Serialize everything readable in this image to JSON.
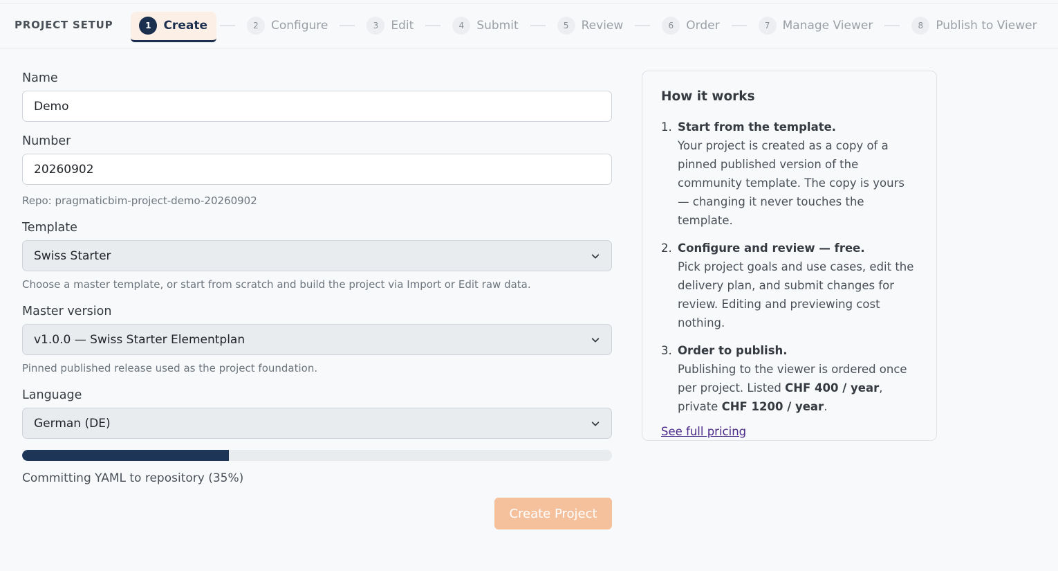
{
  "stepper": {
    "title": "PROJECT SETUP",
    "steps": [
      {
        "num": "1",
        "label": "Create"
      },
      {
        "num": "2",
        "label": "Configure"
      },
      {
        "num": "3",
        "label": "Edit"
      },
      {
        "num": "4",
        "label": "Submit"
      },
      {
        "num": "5",
        "label": "Review"
      },
      {
        "num": "6",
        "label": "Order"
      },
      {
        "num": "7",
        "label": "Manage Viewer"
      },
      {
        "num": "8",
        "label": "Publish to Viewer"
      }
    ],
    "active_step": 1
  },
  "form": {
    "name": {
      "label": "Name",
      "value": "Demo"
    },
    "number": {
      "label": "Number",
      "value": "20260902",
      "help": "Repo: pragmaticbim-project-demo-20260902"
    },
    "template": {
      "label": "Template",
      "value": "Swiss Starter",
      "help": "Choose a master template, or start from scratch and build the project via Import or Edit raw data."
    },
    "master_version": {
      "label": "Master version",
      "value": "v1.0.0 — Swiss Starter Elementplan",
      "help": "Pinned published release used as the project foundation."
    },
    "language": {
      "label": "Language",
      "value": "German (DE)"
    },
    "progress": {
      "percent": 35,
      "text": "Committing YAML to repository (35%)"
    },
    "submit_label": "Create Project"
  },
  "colors": {
    "primary": "#1b2f4f",
    "accent_disabled": "#f5c19d",
    "active_step_bg": "#fcefe6",
    "link": "#4b2a8a"
  },
  "how_it_works": {
    "title": "How it works",
    "items": [
      {
        "num": "1.",
        "heading": "Start from the template.",
        "text": "Your project is created as a copy of a pinned published version of the community template. The copy is yours — changing it never touches the template."
      },
      {
        "num": "2.",
        "heading": "Configure and review — free.",
        "text": "Pick project goals and use cases, edit the delivery plan, and submit changes for review. Editing and previewing cost nothing."
      },
      {
        "num": "3.",
        "heading": "Order to publish.",
        "text_before": "Publishing to the viewer is ordered once per project. Listed ",
        "listed_price": "CHF 400 / year",
        "text_mid": ", private ",
        "private_price": "CHF 1200 / year",
        "text_after": "."
      }
    ],
    "link": "See full pricing"
  }
}
